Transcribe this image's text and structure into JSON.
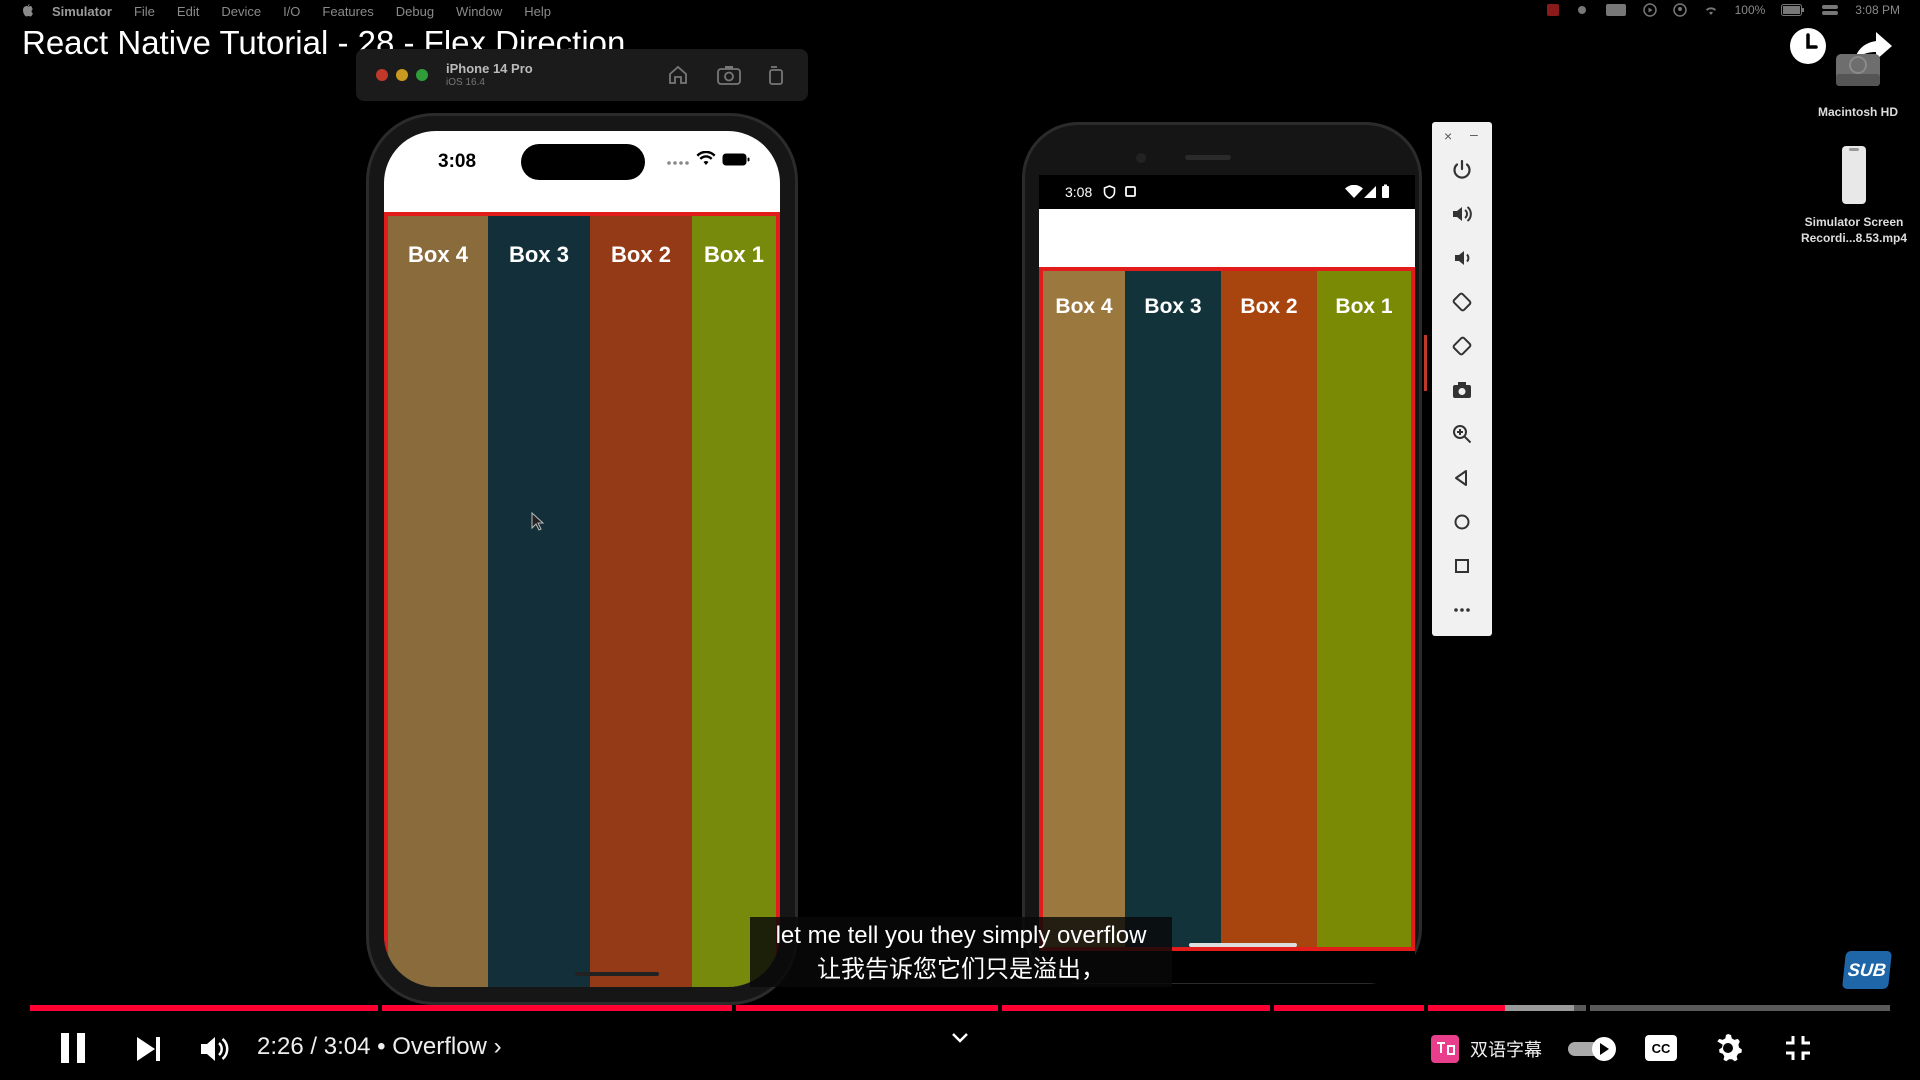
{
  "menubar": {
    "app": "Simulator",
    "items": [
      "File",
      "Edit",
      "Device",
      "I/O",
      "Features",
      "Debug",
      "Window",
      "Help"
    ],
    "battery": "100%",
    "time": "3:08 PM"
  },
  "video": {
    "title": "React Native Tutorial - 28 - Flex Direction"
  },
  "desktop": {
    "disk_label": "Macintosh HD",
    "file_label_line1": "Simulator Screen",
    "file_label_line2": "Recordi...8.53.mp4"
  },
  "simulator": {
    "device_name": "iPhone 14 Pro",
    "os": "iOS 16.4"
  },
  "iphone": {
    "time": "3:08",
    "boxes": [
      {
        "label": "Box 1",
        "color": "#788a0b"
      },
      {
        "label": "Box 2",
        "color": "#953a16"
      },
      {
        "label": "Box 3",
        "color": "#13303a"
      },
      {
        "label": "Box 4",
        "color": "#8a6b3c"
      }
    ]
  },
  "android": {
    "time": "3:08",
    "boxes": [
      {
        "label": "Box 1",
        "color": "#7a8a05"
      },
      {
        "label": "Box 2",
        "color": "#a8440e"
      },
      {
        "label": "Box 3",
        "color": "#13333b"
      },
      {
        "label": "Box 4",
        "color": "#9a783e"
      }
    ]
  },
  "emulator_toolbar": {
    "icons": [
      "power-icon",
      "volume-up-icon",
      "volume-down-icon",
      "rotate-left-icon",
      "rotate-right-icon",
      "camera-icon",
      "zoom-icon",
      "back-icon",
      "home-icon",
      "overview-icon",
      "more-icon"
    ]
  },
  "subtitles": {
    "line1": "let me tell you they simply overflow",
    "line2": "让我告诉您它们只是溢出，"
  },
  "sub_badge": "SUB",
  "player": {
    "current_time": "2:26",
    "duration": "3:04",
    "chapter": "Overflow",
    "played_fraction": 0.793,
    "buffered_fraction": 0.83,
    "bilingual_label": "双语字幕",
    "accent": "#ff0033"
  }
}
